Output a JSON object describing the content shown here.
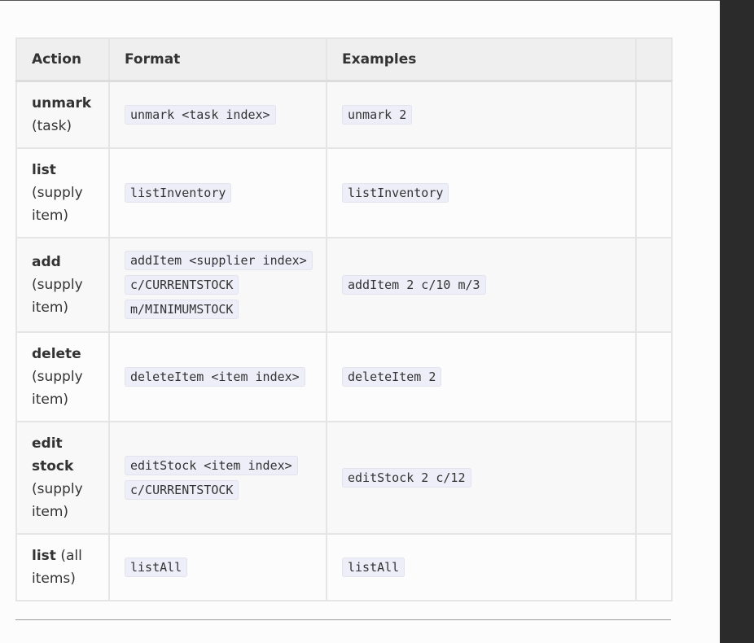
{
  "table": {
    "headers": [
      "Action",
      "Format",
      "Examples",
      ""
    ],
    "rows": [
      {
        "action": "unmark",
        "desc": "(task)",
        "format": "unmark <task index>",
        "example": "unmark 2"
      },
      {
        "action": "list",
        "desc": "(supply item)",
        "format": "listInventory",
        "example": "listInventory"
      },
      {
        "action": "add",
        "desc": "(supply item)",
        "format": "addItem <supplier index> c/CURRENTSTOCK m/MINIMUMSTOCK",
        "example": "addItem 2 c/10 m/3"
      },
      {
        "action": "delete",
        "desc": "(supply item)",
        "format": "deleteItem <item index>",
        "example": "deleteItem 2"
      },
      {
        "action": "edit stock",
        "desc": "(supply item)",
        "format": "editStock <item index> c/CURRENTSTOCK",
        "example": "editStock 2 c/12"
      },
      {
        "action": "list",
        "desc": "(all items)",
        "format": "listAll",
        "example": "listAll"
      }
    ]
  },
  "colors": {
    "page_background": "#fcfcfc",
    "header_background": "#efefef",
    "code_background": "#eeeef9",
    "side_panel": "#2b2b2b",
    "text": "#333333"
  }
}
